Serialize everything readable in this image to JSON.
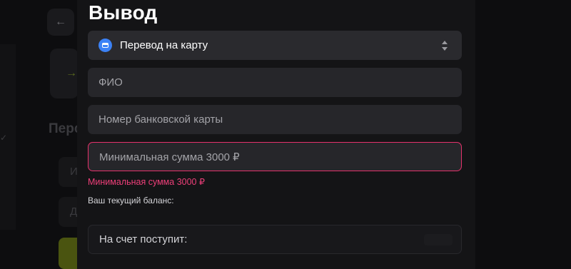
{
  "modal": {
    "title": "Вывод",
    "method_select": {
      "value": "Перевод на карту",
      "icon": "credit-card-icon"
    },
    "name_field": {
      "placeholder": "ФИО"
    },
    "card_field": {
      "placeholder": "Номер банковской карты"
    },
    "amount_field": {
      "placeholder": "Минимальная сумма 3000 ₽"
    },
    "amount_error": "Минимальная сумма 3000 ₽",
    "balance_label": "Ваш текущий баланс:",
    "receive_label": "На счет поступит:"
  },
  "background": {
    "back_icon": "←",
    "heading": "Перс",
    "field_1": "И",
    "field_2": "Д",
    "check_icon": "✓",
    "arrow_icon": "→"
  },
  "colors": {
    "accent_blue": "#3c82f6",
    "error": "#ee3f79",
    "modal_bg": "#141416",
    "field_bg": "#26262a"
  }
}
